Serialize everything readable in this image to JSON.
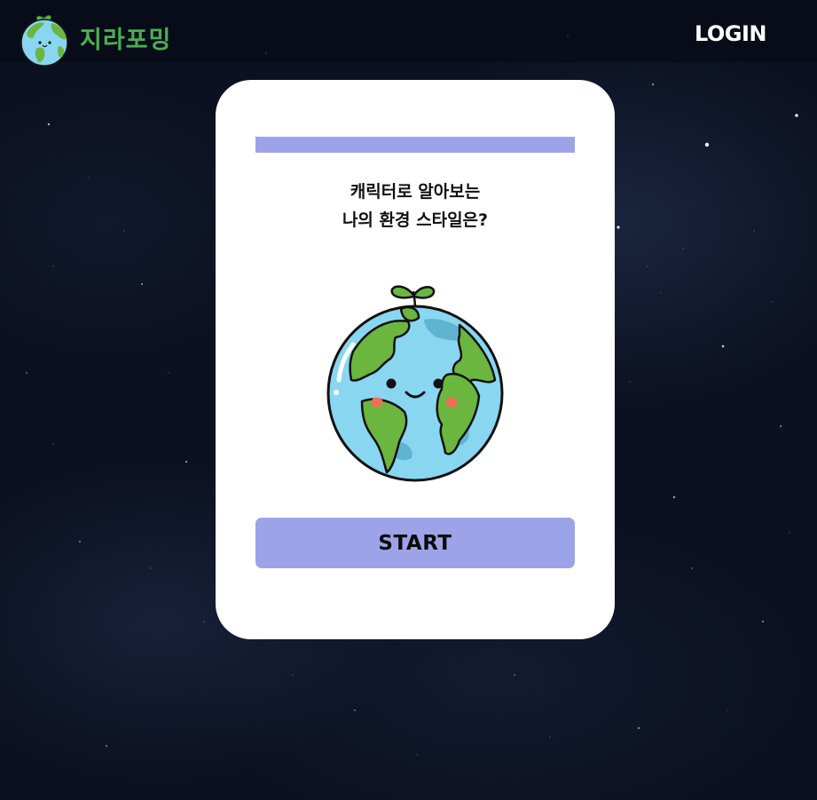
{
  "header": {
    "brand_name": "지라포밍",
    "login_label": "LOGIN",
    "logo_icon": "earth-sprout-icon"
  },
  "card": {
    "progress": 1.0,
    "title_line1": "캐릭터로 알아보는",
    "title_line2": "나의 환경 스타일은?",
    "illustration": "earth-character-icon",
    "start_label": "START"
  },
  "colors": {
    "background": "#0b1120",
    "brand_green": "#4caf50",
    "accent_lavender": "#9da3e8",
    "earth_ocean": "#89d6f1",
    "earth_land": "#6ab63f",
    "card_bg": "#ffffff"
  }
}
